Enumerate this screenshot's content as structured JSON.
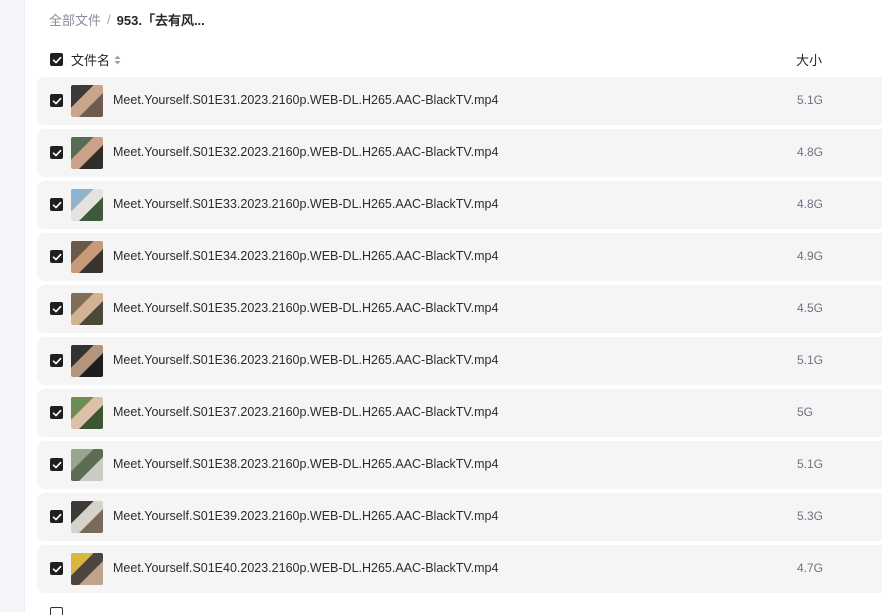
{
  "breadcrumb": {
    "root": "全部文件",
    "separator": "/",
    "current": "953.「去有风..."
  },
  "header": {
    "name_label": "文件名",
    "size_label": "大小",
    "sort_icon": "sort-icon",
    "select_all_checked": true
  },
  "files": [
    {
      "name": "Meet.Yourself.S01E31.2023.2160p.WEB-DL.H265.AAC-BlackTV.mp4",
      "size": "5.1G",
      "checked": true,
      "thumb_colors": [
        "#3b3a38",
        "#c9a58c",
        "#6e5a4f"
      ]
    },
    {
      "name": "Meet.Yourself.S01E32.2023.2160p.WEB-DL.H265.AAC-BlackTV.mp4",
      "size": "4.8G",
      "checked": true,
      "thumb_colors": [
        "#5a6b55",
        "#caa48a",
        "#2e2e2b"
      ]
    },
    {
      "name": "Meet.Yourself.S01E33.2023.2160p.WEB-DL.H265.AAC-BlackTV.mp4",
      "size": "4.8G",
      "checked": true,
      "thumb_colors": [
        "#8fb3cf",
        "#e6e2dd",
        "#3f5a3a"
      ]
    },
    {
      "name": "Meet.Yourself.S01E34.2023.2160p.WEB-DL.H265.AAC-BlackTV.mp4",
      "size": "4.9G",
      "checked": true,
      "thumb_colors": [
        "#6b5a48",
        "#c79a7a",
        "#3a322c"
      ]
    },
    {
      "name": "Meet.Yourself.S01E35.2023.2160p.WEB-DL.H265.AAC-BlackTV.mp4",
      "size": "4.5G",
      "checked": true,
      "thumb_colors": [
        "#7f6e55",
        "#d2b394",
        "#4a4a3a"
      ]
    },
    {
      "name": "Meet.Yourself.S01E36.2023.2160p.WEB-DL.H265.AAC-BlackTV.mp4",
      "size": "5.1G",
      "checked": true,
      "thumb_colors": [
        "#2f3331",
        "#b5947c",
        "#1c1e1d"
      ]
    },
    {
      "name": "Meet.Yourself.S01E37.2023.2160p.WEB-DL.H265.AAC-BlackTV.mp4",
      "size": "5G",
      "checked": true,
      "thumb_colors": [
        "#6d8d55",
        "#dcc0a8",
        "#3e5533"
      ]
    },
    {
      "name": "Meet.Yourself.S01E38.2023.2160p.WEB-DL.H265.AAC-BlackTV.mp4",
      "size": "5.1G",
      "checked": true,
      "thumb_colors": [
        "#9aa58f",
        "#5d6b52",
        "#c9ccc4"
      ]
    },
    {
      "name": "Meet.Yourself.S01E39.2023.2160p.WEB-DL.H265.AAC-BlackTV.mp4",
      "size": "5.3G",
      "checked": true,
      "thumb_colors": [
        "#3e3a36",
        "#d6d2cc",
        "#7a6a5c"
      ]
    },
    {
      "name": "Meet.Yourself.S01E40.2023.2160p.WEB-DL.H265.AAC-BlackTV.mp4",
      "size": "4.7G",
      "checked": true,
      "thumb_colors": [
        "#d9b640",
        "#4d4640",
        "#bfa48c"
      ]
    }
  ]
}
